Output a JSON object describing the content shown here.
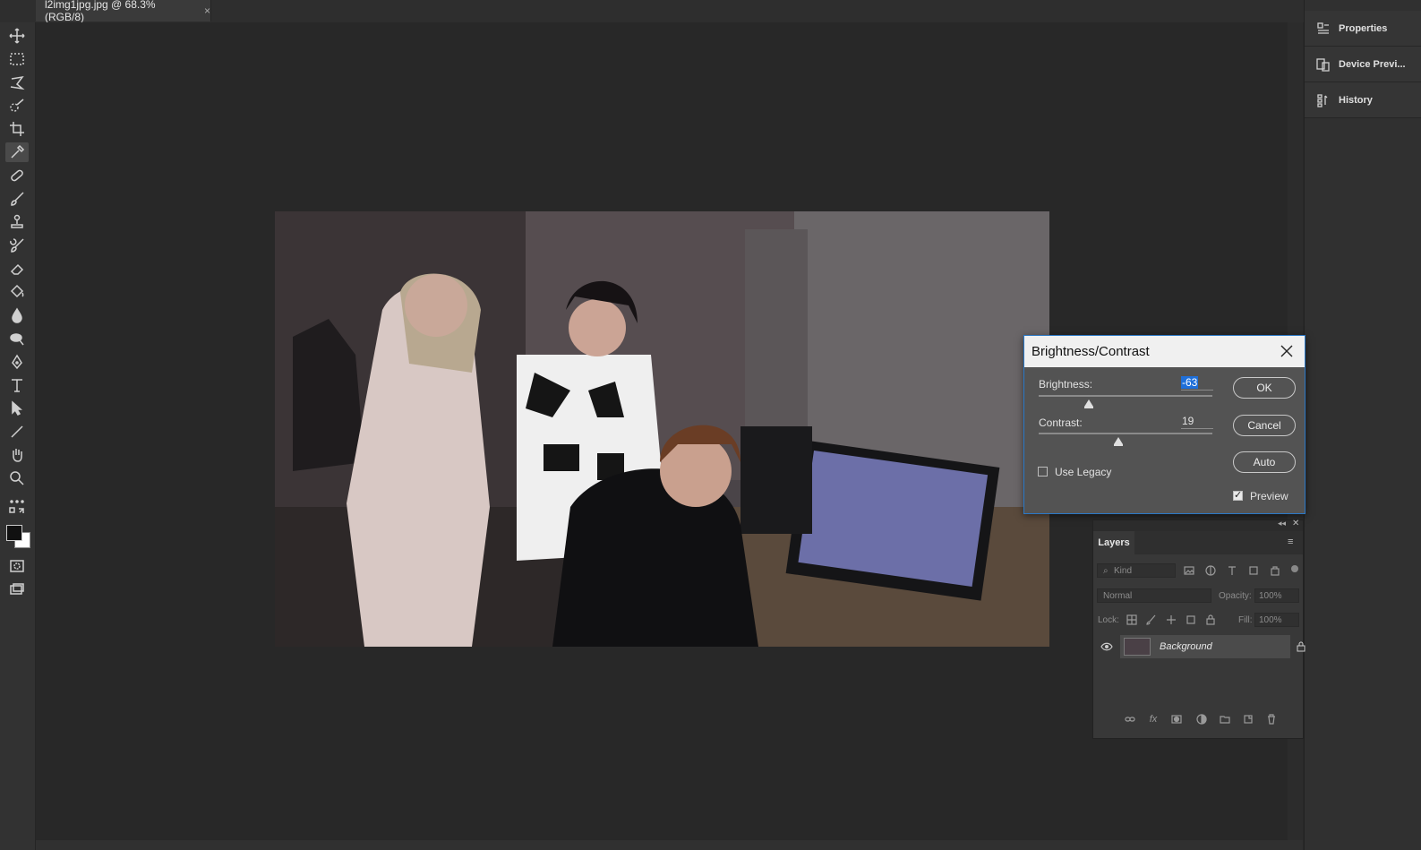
{
  "document_tab": {
    "title": "l2img1jpg.jpg @ 68.3% (RGB/8)",
    "close": "×"
  },
  "tools": [
    "move-tool-icon",
    "marquee-tool-icon",
    "lasso-tool-icon",
    "quick-select-tool-icon",
    "crop-tool-icon",
    "eyedropper-tool-icon",
    "healing-brush-tool-icon",
    "brush-tool-icon",
    "clone-stamp-tool-icon",
    "history-brush-tool-icon",
    "eraser-tool-icon",
    "paint-bucket-tool-icon",
    "blur-tool-icon",
    "dodge-tool-icon",
    "pen-tool-icon",
    "type-tool-icon",
    "path-select-tool-icon",
    "line-tool-icon",
    "hand-tool-icon",
    "zoom-tool-icon",
    "more-tools-icon"
  ],
  "active_tool": "eyedropper-tool-icon",
  "colors": {
    "foreground": "#111111",
    "background": "#ffffff",
    "accent": "#2b78c6",
    "selection": "#1e6fd9"
  },
  "right_panels": [
    {
      "label": "Properties",
      "icon": "properties-icon"
    },
    {
      "label": "Device Previ...",
      "icon": "device-preview-icon"
    },
    {
      "label": "History",
      "icon": "history-icon"
    }
  ],
  "dialog": {
    "title": "Brightness/Contrast",
    "brightness_label": "Brightness:",
    "brightness_value": "-63",
    "brightness_level": -63,
    "contrast_label": "Contrast:",
    "contrast_value": "19",
    "contrast_level": 19,
    "use_legacy_label": "Use Legacy",
    "use_legacy_checked": false,
    "preview_label": "Preview",
    "preview_checked": true,
    "ok_label": "OK",
    "cancel_label": "Cancel",
    "auto_label": "Auto"
  },
  "layers": {
    "tab_label": "Layers",
    "kind_placeholder": "Kind",
    "blend_mode": "Normal",
    "opacity_label": "Opacity:",
    "opacity_value": "100%",
    "lock_label": "Lock:",
    "fill_label": "Fill:",
    "fill_value": "100%",
    "layer_items": [
      {
        "name": "Background",
        "visible": true,
        "locked": true
      }
    ]
  }
}
